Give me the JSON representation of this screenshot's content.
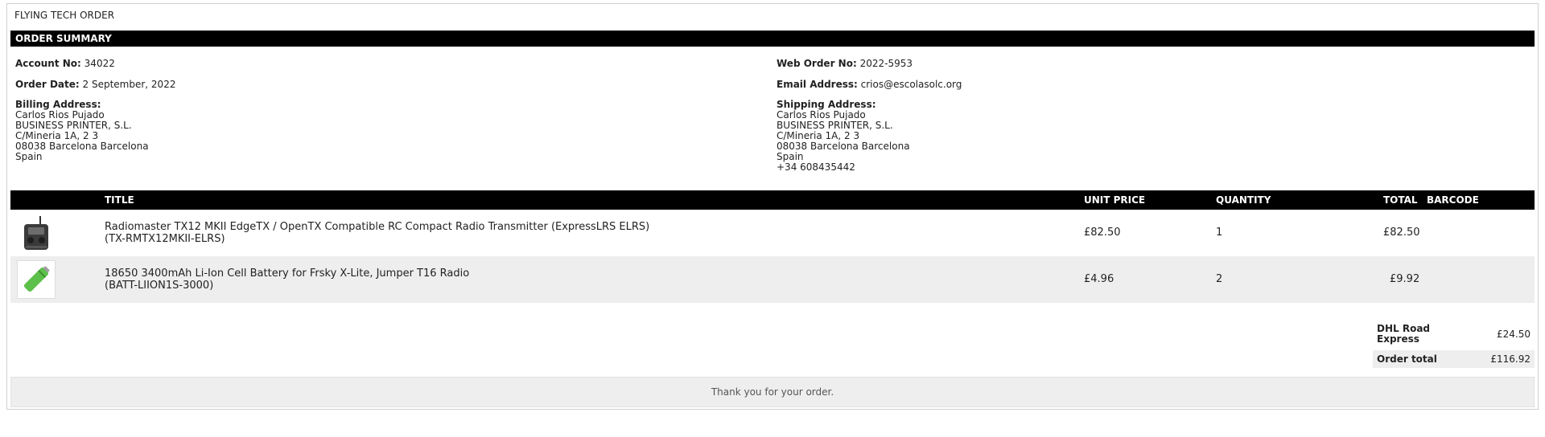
{
  "header": {
    "brand": "FLYING TECH ORDER",
    "summary_title": "ORDER SUMMARY"
  },
  "order": {
    "account_label": "Account No:",
    "account_value": "34022",
    "web_order_label": "Web Order No:",
    "web_order_value": "2022-5953",
    "date_label": "Order Date:",
    "date_value": "2 September, 2022",
    "email_label": "Email Address:",
    "email_value": "crios@escolasolc.org",
    "billing": {
      "label": "Billing Address:",
      "lines": [
        "Carlos Rios Pujado",
        "BUSINESS PRINTER, S.L.",
        "C/Mineria 1A, 2 3",
        "08038 Barcelona Barcelona",
        "Spain"
      ]
    },
    "shipping": {
      "label": "Shipping Address:",
      "lines": [
        "Carlos Rios Pujado",
        "BUSINESS PRINTER, S.L.",
        "C/Mineria 1A, 2 3",
        "08038 Barcelona Barcelona",
        "Spain",
        "+34 608435442"
      ]
    }
  },
  "table": {
    "columns": {
      "title": "TITLE",
      "unit_price": "UNIT PRICE",
      "quantity": "QUANTITY",
      "total": "TOTAL",
      "barcode": "BARCODE"
    },
    "items": [
      {
        "title": "Radiomaster TX12 MKII EdgeTX / OpenTX Compatible RC Compact Radio Transmitter (ExpressLRS ELRS)",
        "sku": "(TX-RMTX12MKII-ELRS)",
        "unit_price": "£82.50",
        "quantity": "1",
        "total": "£82.50",
        "thumb_icon": "radio-transmitter-icon"
      },
      {
        "title": "18650 3400mAh Li-Ion Cell Battery for Frsky X-Lite, Jumper T16 Radio",
        "sku": "(BATT-LIION1S-3000)",
        "unit_price": "£4.96",
        "quantity": "2",
        "total": "£9.92",
        "thumb_icon": "battery-icon"
      }
    ]
  },
  "totals": {
    "shipping_method_line1": "DHL Road",
    "shipping_method_line2": "Express",
    "shipping_cost": "£24.50",
    "order_total_label": "Order total",
    "order_total_value": "£116.92"
  },
  "footer": {
    "message": "Thank you for your order."
  },
  "colors": {
    "bar": "#000000",
    "row_alt": "#eeeeee",
    "battery_green": "#5cc04a"
  }
}
